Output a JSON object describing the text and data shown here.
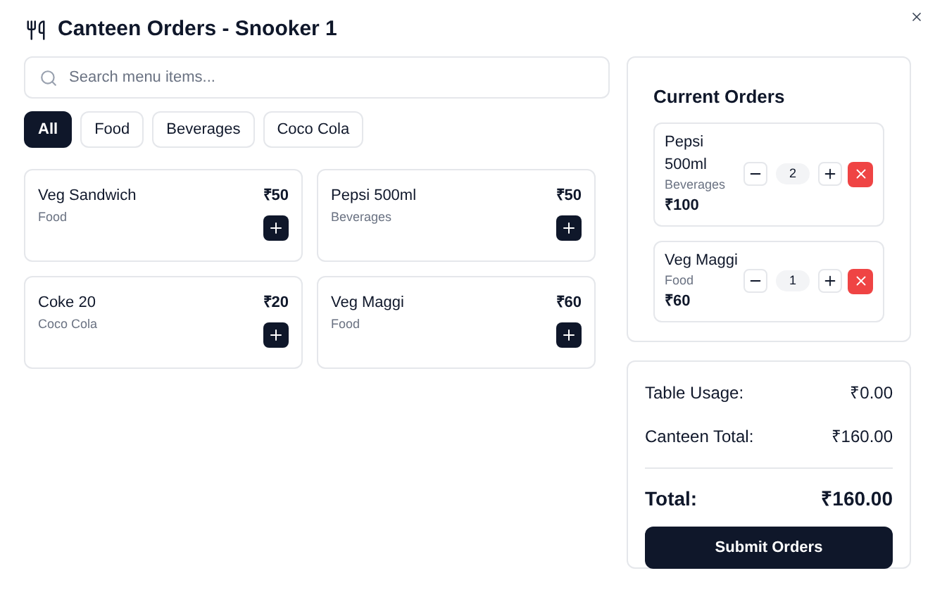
{
  "title": "Canteen Orders - Snooker 1",
  "search": {
    "placeholder": "Search menu items..."
  },
  "filters": [
    {
      "label": "All",
      "selected": true
    },
    {
      "label": "Food",
      "selected": false
    },
    {
      "label": "Beverages",
      "selected": false
    },
    {
      "label": "Coco Cola",
      "selected": false
    }
  ],
  "menu_items": [
    {
      "name": "Veg Sandwich",
      "category": "Food",
      "price": "₹50"
    },
    {
      "name": "Pepsi 500ml",
      "category": "Beverages",
      "price": "₹50"
    },
    {
      "name": "Coke 20",
      "category": "Coco Cola",
      "price": "₹20"
    },
    {
      "name": "Veg Maggi",
      "category": "Food",
      "price": "₹60"
    }
  ],
  "current_orders": {
    "title": "Current Orders",
    "items": [
      {
        "name": "Pepsi 500ml",
        "category": "Beverages",
        "total": "₹100",
        "quantity": "2"
      },
      {
        "name": "Veg Maggi",
        "category": "Food",
        "total": "₹60",
        "quantity": "1"
      }
    ]
  },
  "summary": {
    "rows": [
      {
        "label": "Table Usage:",
        "value": "₹0.00"
      },
      {
        "label": "Canteen Total:",
        "value": "₹160.00"
      }
    ],
    "total_label": "Total:",
    "total_value": "₹160.00",
    "submit": "Submit Orders"
  }
}
